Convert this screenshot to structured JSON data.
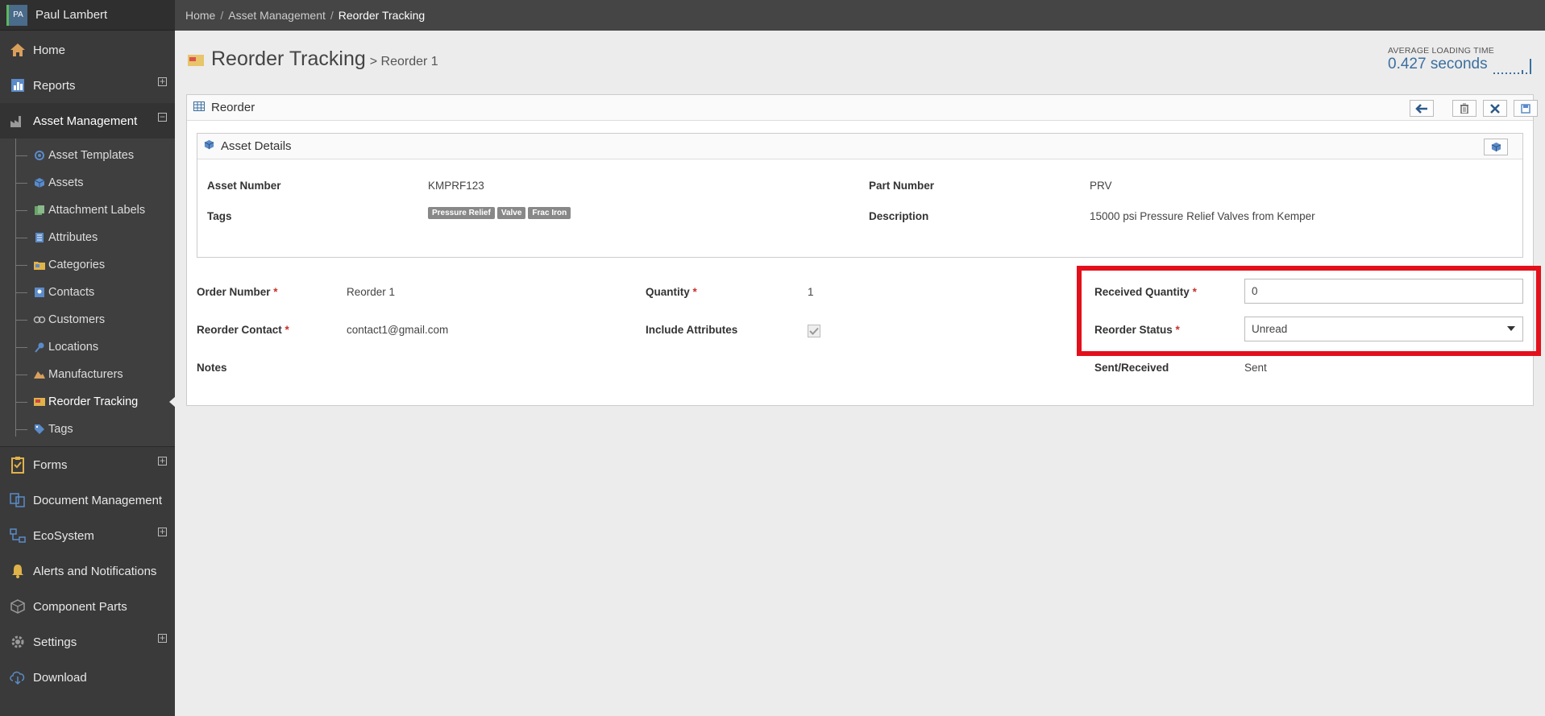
{
  "user": {
    "initials": "PA",
    "name": "Paul Lambert"
  },
  "breadcrumb": [
    "Home",
    "Asset Management",
    "Reorder Tracking"
  ],
  "breadcrumb_sep": "/",
  "sidebar": {
    "items": [
      {
        "label": "Home",
        "icon": "home-icon"
      },
      {
        "label": "Reports",
        "icon": "reports-icon",
        "expander": "+"
      },
      {
        "label": "Asset Management",
        "icon": "factory-icon",
        "expander": "−"
      }
    ],
    "sub_items": [
      {
        "label": "Asset Templates",
        "icon": "templates-icon"
      },
      {
        "label": "Assets",
        "icon": "cube-icon"
      },
      {
        "label": "Attachment Labels",
        "icon": "label-icon"
      },
      {
        "label": "Attributes",
        "icon": "list-icon"
      },
      {
        "label": "Categories",
        "icon": "folder-icon"
      },
      {
        "label": "Contacts",
        "icon": "contact-icon"
      },
      {
        "label": "Customers",
        "icon": "customers-icon"
      },
      {
        "label": "Locations",
        "icon": "pin-icon"
      },
      {
        "label": "Manufacturers",
        "icon": "manufacturer-icon"
      },
      {
        "label": "Reorder Tracking",
        "icon": "reorder-icon",
        "active": true
      },
      {
        "label": "Tags",
        "icon": "tag-icon"
      }
    ],
    "bottom_items": [
      {
        "label": "Forms",
        "icon": "clipboard-icon",
        "expander": "+"
      },
      {
        "label": "Document Management",
        "icon": "documents-icon"
      },
      {
        "label": "EcoSystem",
        "icon": "ecosystem-icon",
        "expander": "+"
      },
      {
        "label": "Alerts and Notifications",
        "icon": "bell-icon"
      },
      {
        "label": "Component Parts",
        "icon": "component-icon"
      },
      {
        "label": "Settings",
        "icon": "gear-icon",
        "expander": "+"
      },
      {
        "label": "Download",
        "icon": "download-icon"
      }
    ]
  },
  "page": {
    "title": "Reorder Tracking",
    "subtitle": "> Reorder 1"
  },
  "loading": {
    "label": "AVERAGE LOADING TIME",
    "value": "0.427 seconds"
  },
  "panel": {
    "title": "Reorder"
  },
  "asset_details": {
    "title": "Asset Details",
    "asset_number_label": "Asset Number",
    "asset_number": "KMPRF123",
    "tags_label": "Tags",
    "tags": [
      "Pressure Relief",
      "Valve",
      "Frac Iron"
    ],
    "part_number_label": "Part Number",
    "part_number": "PRV",
    "description_label": "Description",
    "description": "15000 psi Pressure Relief Valves from Kemper"
  },
  "form": {
    "order_number_label": "Order Number",
    "order_number": "Reorder 1",
    "reorder_contact_label": "Reorder Contact",
    "reorder_contact": "contact1@gmail.com",
    "notes_label": "Notes",
    "quantity_label": "Quantity",
    "quantity": "1",
    "include_attributes_label": "Include Attributes",
    "include_attributes_checked": true,
    "received_quantity_label": "Received Quantity",
    "received_quantity": "0",
    "reorder_status_label": "Reorder Status",
    "reorder_status": "Unread",
    "sent_received_label": "Sent/Received",
    "sent_received": "Sent",
    "required_mark": "*"
  },
  "colors": {
    "highlight": "#e3101b",
    "accent": "#3b6fa0",
    "sidebar": "#3a3a3a"
  }
}
